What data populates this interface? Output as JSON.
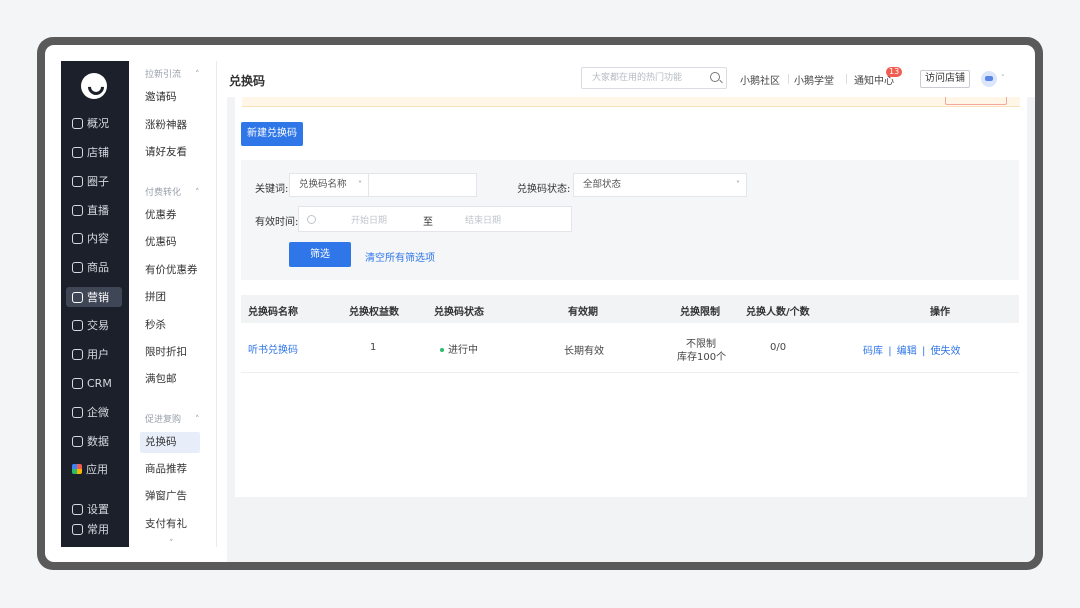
{
  "nav": {
    "items": [
      {
        "label": "概况",
        "icon": "clock-icon"
      },
      {
        "label": "店铺",
        "icon": "store-icon"
      },
      {
        "label": "圈子",
        "icon": "group-icon"
      },
      {
        "label": "直播",
        "icon": "live-icon"
      },
      {
        "label": "内容",
        "icon": "document-icon"
      },
      {
        "label": "商品",
        "icon": "product-icon"
      },
      {
        "label": "营销",
        "icon": "megaphone-icon",
        "active": true
      },
      {
        "label": "交易",
        "icon": "trade-icon"
      },
      {
        "label": "用户",
        "icon": "user-icon"
      },
      {
        "label": "CRM",
        "icon": "crm-icon"
      },
      {
        "label": "企微",
        "icon": "chat-icon"
      },
      {
        "label": "数据",
        "icon": "data-icon"
      },
      {
        "label": "应用",
        "icon": "apps-icon"
      },
      {
        "label": "设置",
        "icon": "gear-icon"
      },
      {
        "label": "常用",
        "icon": "list-icon"
      }
    ]
  },
  "submenu": {
    "group1": {
      "title": "拉新引流",
      "chevron": "˄"
    },
    "group1_items": [
      "邀请码",
      "涨粉神器",
      "请好友看"
    ],
    "group2": {
      "title": "付费转化",
      "chevron": "˄"
    },
    "group2_items": [
      "优惠券",
      "优惠码",
      "有价优惠券",
      "拼团",
      "秒杀",
      "限时折扣",
      "满包邮"
    ],
    "group3": {
      "title": "促进复购",
      "chevron": "˄"
    },
    "group3_items": [
      "兑换码",
      "商品推荐",
      "弹窗广告",
      "支付有礼"
    ],
    "more_chevron": "˅"
  },
  "header": {
    "title": "兑换码",
    "search_placeholder": "大家都在用的热门功能",
    "links": [
      "小鹅社区",
      "小鹅学堂",
      "通知中心"
    ],
    "notify_count": "13",
    "visit_store": "访问店铺",
    "caret": "˅"
  },
  "toolbar": {
    "new_button": "新建兑换码"
  },
  "filters": {
    "keyword_label": "关键词:",
    "keyword_type": "兑换码名称",
    "keyword_value": "",
    "status_label": "兑换码状态:",
    "status_value": "全部状态",
    "valid_label": "有效时间:",
    "start_placeholder": "开始日期",
    "to": "至",
    "end_placeholder": "结束日期",
    "filter_button": "筛选",
    "clear_link": "清空所有筛选项",
    "dropdown_caret": "˅"
  },
  "table": {
    "headers": [
      "兑换码名称",
      "兑换权益数",
      "兑换码状态",
      "有效期",
      "兑换限制",
      "兑换人数/个数",
      "操作"
    ],
    "rows": [
      {
        "name": "听书兑换码",
        "benefits": "1",
        "status": "进行中",
        "validity": "长期有效",
        "limit_line1": "不限制",
        "limit_line2": "库存100个",
        "count": "0/0",
        "actions": [
          "码库",
          "编辑",
          "使失效"
        ],
        "sep": "|"
      }
    ]
  }
}
